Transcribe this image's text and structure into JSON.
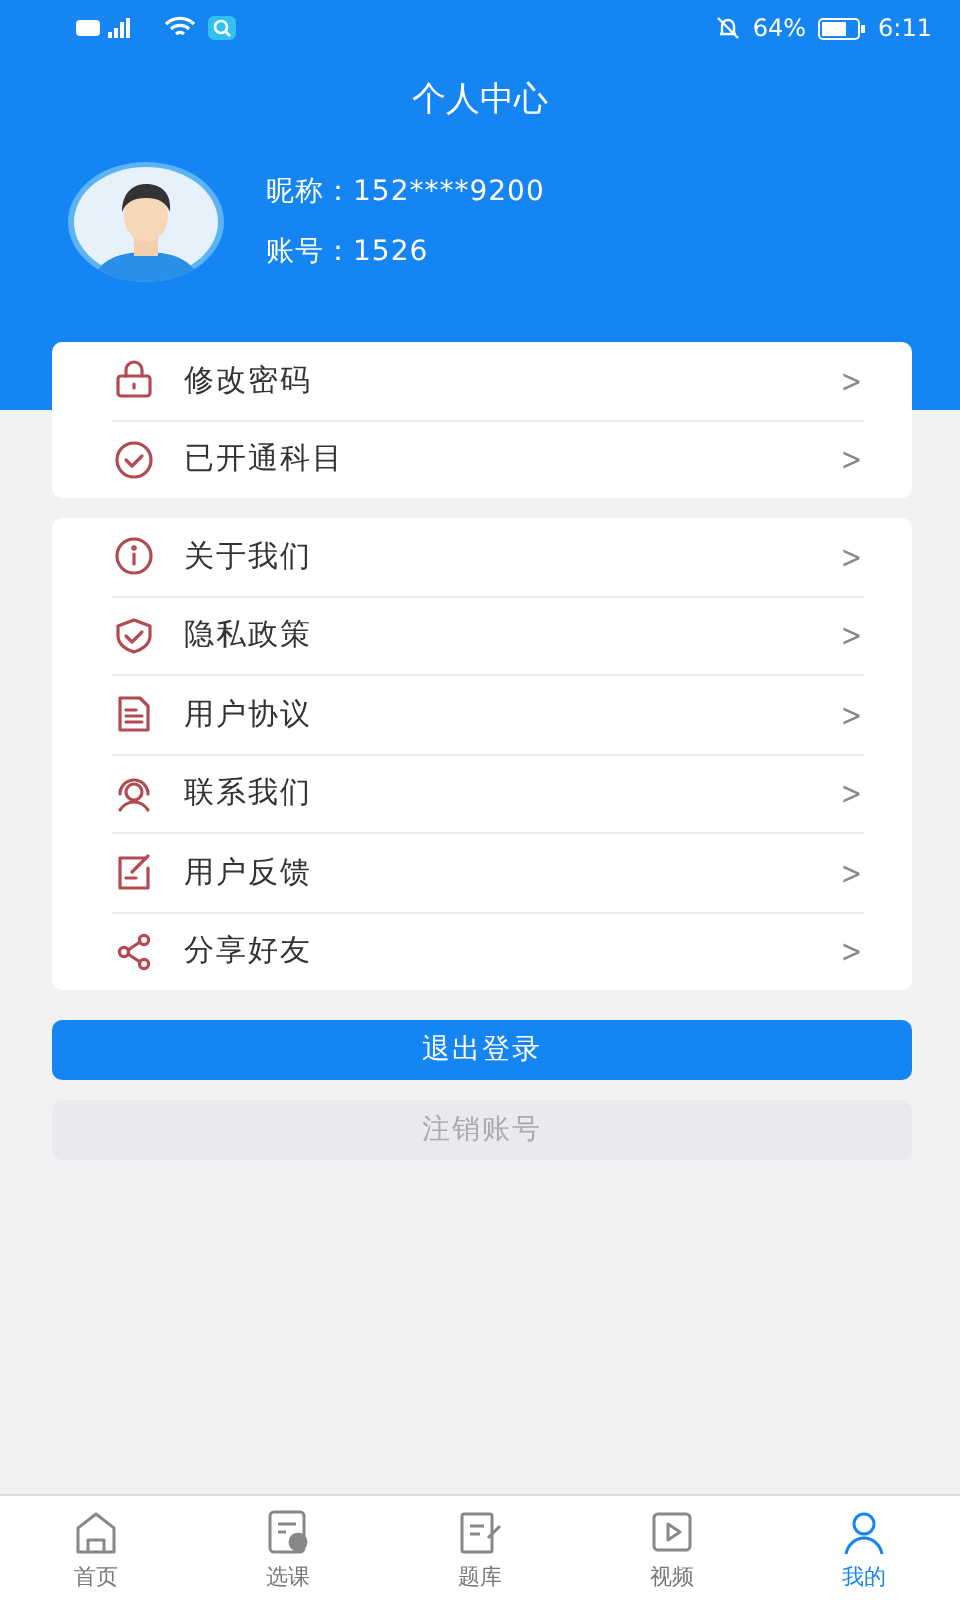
{
  "status_bar": {
    "battery": "64%",
    "time": "6:11"
  },
  "header": {
    "title": "个人中心",
    "nickname": "昵称：152****9200",
    "account": "账号：1526"
  },
  "menu_groups": [
    {
      "items": [
        {
          "label": "修改密码",
          "chevron": ">"
        },
        {
          "label": "已开通科目",
          "chevron": ">"
        }
      ]
    },
    {
      "items": [
        {
          "label": "关于我们",
          "chevron": ">"
        },
        {
          "label": "隐私政策",
          "chevron": ">"
        },
        {
          "label": "用户协议",
          "chevron": ">"
        },
        {
          "label": "联系我们",
          "chevron": ">"
        },
        {
          "label": "用户反馈",
          "chevron": ">"
        },
        {
          "label": "分享好友",
          "chevron": ">"
        }
      ]
    }
  ],
  "buttons": [
    {
      "label": "退出登录",
      "disabled": false
    },
    {
      "label": "注销账号",
      "disabled": true
    }
  ],
  "tab_bar": [
    {
      "label": "首页",
      "selected": false
    },
    {
      "label": "选课",
      "selected": false
    },
    {
      "label": "题库",
      "selected": false
    },
    {
      "label": "视频",
      "selected": false
    },
    {
      "label": "我的",
      "selected": true
    }
  ]
}
